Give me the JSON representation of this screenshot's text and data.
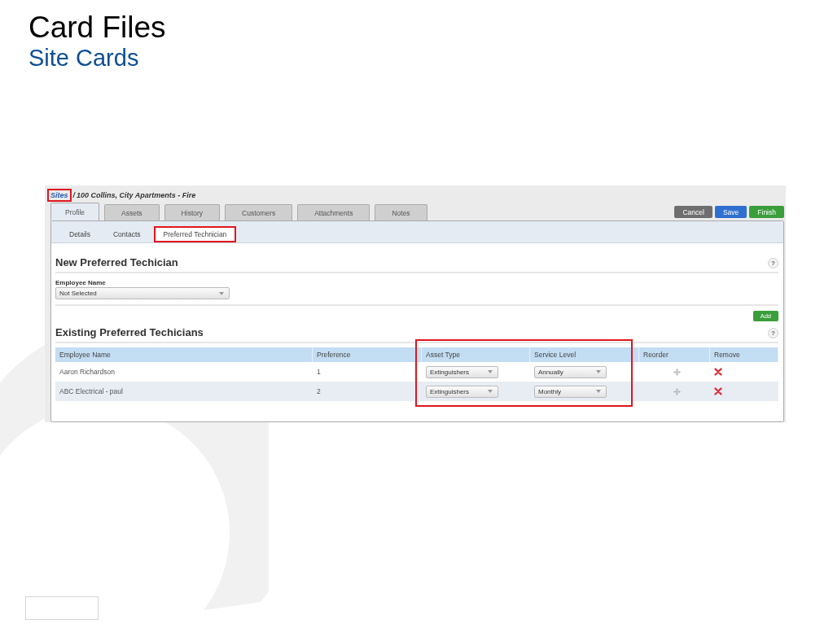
{
  "slide": {
    "title": "Card Files",
    "subtitle": "Site Cards"
  },
  "breadcrumb": {
    "link": {
      "label": "Sites",
      "highlighted": true
    },
    "separator": "/",
    "current": "100 Collins, City Apartments - Fire"
  },
  "tabs": [
    {
      "label": "Profile",
      "selected": true
    },
    {
      "label": "Assets",
      "selected": false
    },
    {
      "label": "History",
      "selected": false
    },
    {
      "label": "Customers",
      "selected": false
    },
    {
      "label": "Attachments",
      "selected": false
    },
    {
      "label": "Notes",
      "selected": false
    }
  ],
  "actions": [
    {
      "label": "Cancel",
      "kind": "cancel"
    },
    {
      "label": "Save",
      "kind": "save"
    },
    {
      "label": "Finish",
      "kind": "finish"
    }
  ],
  "subtabs": [
    {
      "label": "Details",
      "selected": false,
      "highlighted": false
    },
    {
      "label": "Contacts",
      "selected": false,
      "highlighted": false
    },
    {
      "label": "Preferred Technician",
      "selected": true,
      "highlighted": true
    }
  ],
  "new_section": {
    "title": "New Preferred Techician",
    "help": "?",
    "field_label": "Employee Name",
    "select_value": "Not Selected",
    "add_button": "Add"
  },
  "existing_section": {
    "title": "Existing Preferred Techicians",
    "help": "?"
  },
  "table": {
    "columns": [
      {
        "kind": "column",
        "label": "Employee Name"
      },
      {
        "kind": "column",
        "label": "Preference"
      },
      {
        "kind": "group",
        "highlighted": true,
        "columns": [
          {
            "label": "Asset Type"
          },
          {
            "label": "Service Level"
          }
        ]
      },
      {
        "kind": "column",
        "label": "Reorder"
      },
      {
        "kind": "column",
        "label": "Remove"
      }
    ],
    "rows": [
      {
        "employee": "Aaron Richardson",
        "preference": "1",
        "asset_type": "Extinguishers",
        "service_level": "Annually"
      },
      {
        "employee": "ABC Electrical - paul",
        "preference": "2",
        "asset_type": "Extinguishers",
        "service_level": "Monthly"
      }
    ]
  }
}
